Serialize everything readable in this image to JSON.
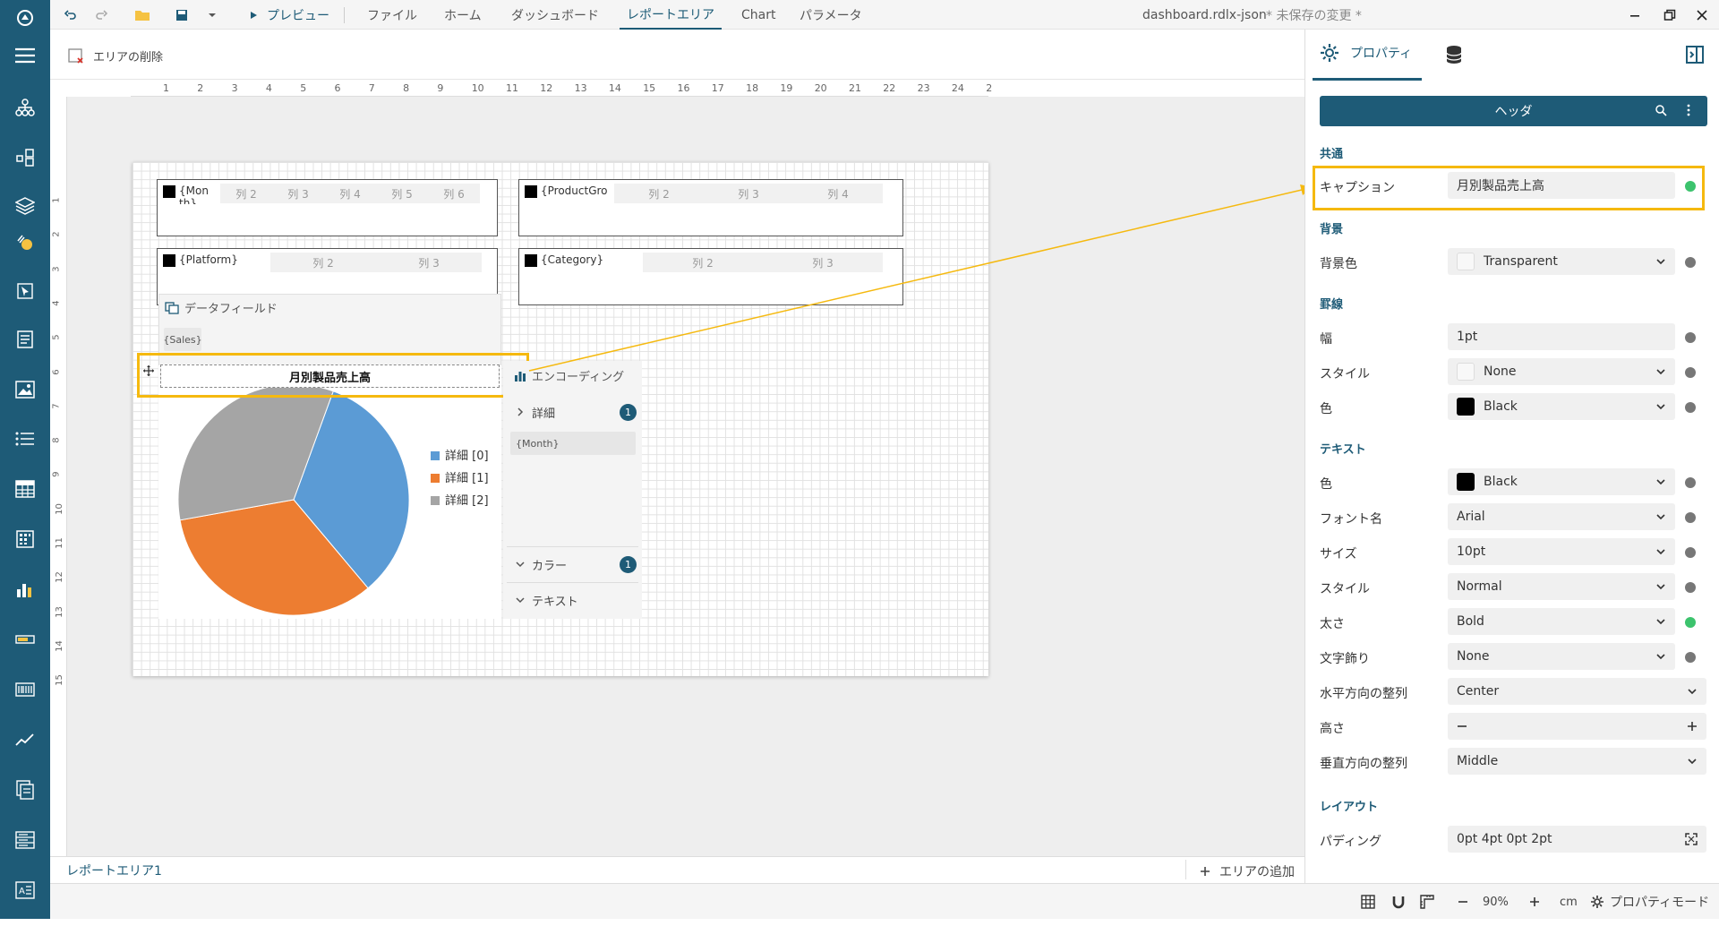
{
  "toolbar": {
    "preview": "プレビュー",
    "menu": [
      "ファイル",
      "ホーム",
      "ダッシュボード",
      "レポートエリア",
      "Chart",
      "パラメータ"
    ],
    "filename": "dashboard.rdlx-json",
    "unsaved": "* 未保存の変更 *",
    "delete_area": "エリアの削除"
  },
  "colors": {
    "sidebar": "#1e5b77",
    "accent": "#f5b90f",
    "header_bar": "#1e5b77",
    "status_green": "#3cc36d"
  },
  "ruler_top": [
    "1",
    "2",
    "3",
    "4",
    "5",
    "6",
    "7",
    "8",
    "9",
    "10",
    "11",
    "12",
    "13",
    "14",
    "15",
    "16",
    "17",
    "18",
    "19",
    "20",
    "21",
    "22",
    "23",
    "24",
    "2"
  ],
  "ruler_left": [
    "1",
    "2",
    "3",
    "4",
    "5",
    "6",
    "7",
    "8",
    "9",
    "10",
    "11",
    "12",
    "13",
    "14",
    "15"
  ],
  "tables": {
    "t1": {
      "head": "{Mon th}",
      "cols": [
        "列 2",
        "列 3",
        "列 4",
        "列 5",
        "列 6"
      ]
    },
    "t2": {
      "head": "{ProductGro",
      "cols": [
        "列 2",
        "列 3",
        "列 4"
      ]
    },
    "t3": {
      "head": "{Platform}",
      "cols": [
        "列 2",
        "列 3"
      ]
    },
    "t4": {
      "head": "{Category}",
      "cols": [
        "列 2",
        "列 3"
      ]
    }
  },
  "chart_panel": {
    "data_field_title": "データフィールド",
    "data_field_value": "{Sales}",
    "caption": "月別製品売上高",
    "encoding_title": "エンコーディング",
    "detail": "詳細",
    "detail_badge": "1",
    "detail_value": "{Month}",
    "color": "カラー",
    "color_badge": "1",
    "text": "テキスト"
  },
  "chart_data": {
    "type": "pie",
    "title": "月別製品売上高",
    "categories": [
      "詳細 [0]",
      "詳細 [1]",
      "詳細 [2]"
    ],
    "values": [
      33.3,
      33.3,
      33.4
    ],
    "colors": [
      "#5b9bd5",
      "#ed7d31",
      "#a5a5a5"
    ],
    "legend": "right"
  },
  "properties": {
    "tab_properties": "プロパティ",
    "header": "ヘッダ",
    "sections": {
      "common": "共通",
      "background": "背景",
      "border": "罫線",
      "text": "テキスト",
      "layout": "レイアウト"
    },
    "caption_label": "キャプション",
    "caption_value": "月別製品売上高",
    "bg_color_label": "背景色",
    "bg_color_value": "Transparent",
    "border_width_label": "幅",
    "border_width_value": "1pt",
    "border_style_label": "スタイル",
    "border_style_value": "None",
    "border_color_label": "色",
    "border_color_value": "Black",
    "text_color_label": "色",
    "text_color_value": "Black",
    "font_name_label": "フォント名",
    "font_name_value": "Arial",
    "size_label": "サイズ",
    "size_value": "10pt",
    "style_label": "スタイル",
    "style_value": "Normal",
    "weight_label": "太さ",
    "weight_value": "Bold",
    "decoration_label": "文字飾り",
    "decoration_value": "None",
    "halign_label": "水平方向の整列",
    "halign_value": "Center",
    "height_label": "高さ",
    "valign_label": "垂直方向の整列",
    "valign_value": "Middle",
    "padding_label": "パディング",
    "padding_value": "0pt 4pt 0pt 2pt"
  },
  "bottom": {
    "tab": "レポートエリア1",
    "add_area": "エリアの追加",
    "zoom": "90%",
    "unit": "cm",
    "prop_mode": "プロパティモード"
  }
}
